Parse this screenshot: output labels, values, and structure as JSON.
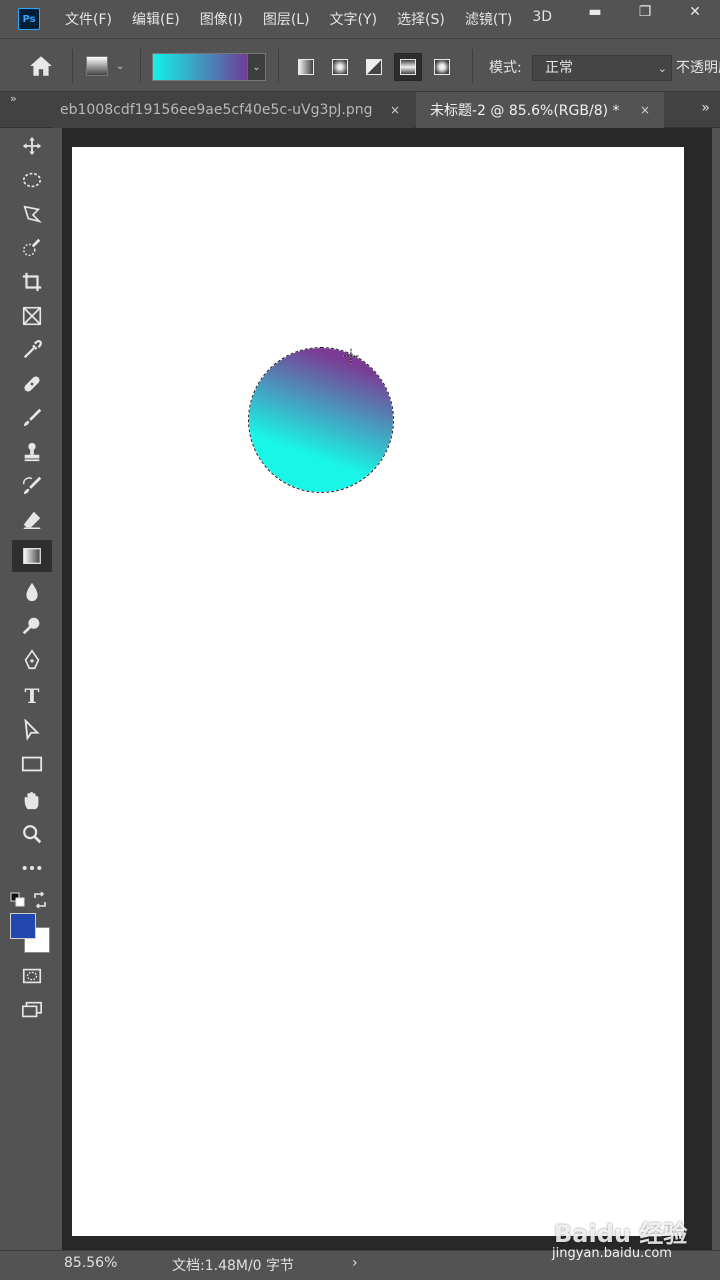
{
  "app": {
    "logo": "Ps"
  },
  "menu": [
    "文件(F)",
    "编辑(E)",
    "图像(I)",
    "图层(L)",
    "文字(Y)",
    "选择(S)",
    "滤镜(T)",
    "3D"
  ],
  "window_controls": {
    "minimize": "▬",
    "restore": "❐",
    "close": "✕"
  },
  "options": {
    "gradient_start_color": "#13f2e8",
    "gradient_end_color": "#6e3d96",
    "mode_label": "模式:",
    "mode_value": "正常",
    "opacity_label": "不透明度"
  },
  "tabs": {
    "collapse": "»",
    "items": [
      {
        "label": "eb1008cdf19156ee9ae5cf40e5c-uVg3pJ.png",
        "close": "×",
        "active": false
      },
      {
        "label": "未标题-2 @ 85.6%(RGB/8) *",
        "close": "×",
        "active": true
      }
    ],
    "more": "»"
  },
  "tools": [
    {
      "icon": "move-icon",
      "selected": false
    },
    {
      "icon": "elliptical-marquee-icon",
      "selected": false
    },
    {
      "icon": "lasso-icon",
      "selected": false
    },
    {
      "icon": "quick-selection-icon",
      "selected": false
    },
    {
      "icon": "crop-icon",
      "selected": false
    },
    {
      "icon": "frame-icon",
      "selected": false
    },
    {
      "icon": "eyedropper-icon",
      "selected": false
    },
    {
      "icon": "healing-brush-icon",
      "selected": false
    },
    {
      "icon": "brush-icon",
      "selected": false
    },
    {
      "icon": "clone-stamp-icon",
      "selected": false
    },
    {
      "icon": "history-brush-icon",
      "selected": false
    },
    {
      "icon": "eraser-icon",
      "selected": false
    },
    {
      "icon": "gradient-icon",
      "selected": true
    },
    {
      "icon": "blur-icon",
      "selected": false
    },
    {
      "icon": "dodge-icon",
      "selected": false
    },
    {
      "icon": "pen-icon",
      "selected": false
    },
    {
      "icon": "type-icon",
      "selected": false,
      "text": "T"
    },
    {
      "icon": "path-selection-icon",
      "selected": false
    },
    {
      "icon": "rectangle-icon",
      "selected": false
    },
    {
      "icon": "hand-icon",
      "selected": false
    },
    {
      "icon": "zoom-icon",
      "selected": false
    },
    {
      "icon": "more-tools-icon",
      "selected": false
    }
  ],
  "colors": {
    "foreground": "#2248b0",
    "background": "#ffffff"
  },
  "canvas": {
    "circle_gradient_start": "#19f5e6",
    "circle_gradient_end": "#7b3a93"
  },
  "status": {
    "zoom": "85.56%",
    "doc_info": "文档:1.48M/0 字节",
    "arrow": "›"
  },
  "watermark": {
    "logo": "Baidu 经验",
    "url": "jingyan.baidu.com"
  }
}
